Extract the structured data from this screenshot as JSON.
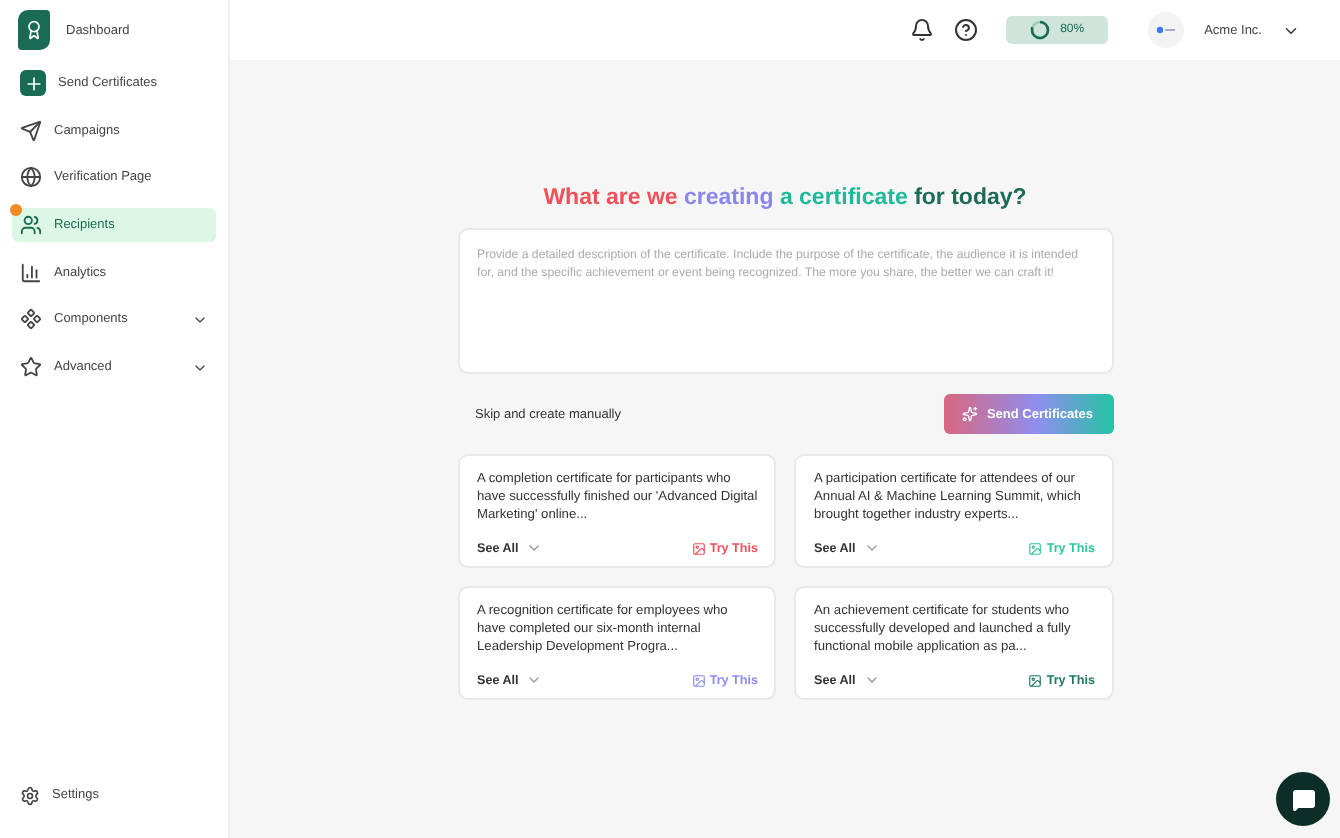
{
  "sidebar": {
    "logo_label": "Dashboard",
    "items": [
      {
        "label": "Send Certificates",
        "kind": "action",
        "selected": false
      },
      {
        "label": "Campaigns",
        "kind": "send",
        "selected": false
      },
      {
        "label": "Verification Page",
        "kind": "globe",
        "selected": false
      },
      {
        "label": "Recipients",
        "kind": "users",
        "selected": true,
        "badge": true
      },
      {
        "label": "Analytics",
        "kind": "chart",
        "selected": false
      },
      {
        "label": "Components",
        "kind": "components",
        "selected": false,
        "expandable": true
      },
      {
        "label": "Advanced",
        "kind": "star",
        "selected": false,
        "expandable": true
      }
    ],
    "footer": {
      "label": "Settings"
    }
  },
  "topbar": {
    "progress": {
      "label": "80%"
    },
    "account": "Acme Inc."
  },
  "heading": [
    {
      "text": "What are we ",
      "color": "#f0505a"
    },
    {
      "text": "creating",
      "color": "#8a86ee"
    },
    {
      "text": " a certificate",
      "color": "#1fb89a"
    },
    {
      "text": " for today?",
      "color": "#1d6b57"
    }
  ],
  "prompt": {
    "placeholder": "Provide a detailed description of the certificate. Include the purpose of the certificate, the audience it is intended for, and the specific achievement or event being recognized. The more you share, the better we can craft it!"
  },
  "skip_link": "Skip and create manually",
  "send_button": "Send Certificates",
  "suggestions": [
    {
      "text": "A completion certificate for participants who have successfully finished our 'Advanced Digital Marketing' online...",
      "more": "See All",
      "action": "Try This",
      "color": "#f0505a"
    },
    {
      "text": "A participation certificate for attendees of our Annual AI & Machine Learning Summit, which brought together industry experts...",
      "more": "See All",
      "action": "Try This",
      "color": "#2cc79a"
    },
    {
      "text": "A recognition certificate for employees who have completed our six-month internal Leadership Development Progra...",
      "more": "See All",
      "action": "Try This",
      "color": "#8a8cf0"
    },
    {
      "text": "An achievement certificate for students who successfully developed and launched a fully functional mobile application as pa...",
      "more": "See All",
      "action": "Try This",
      "color": "#1d7a5c"
    }
  ]
}
